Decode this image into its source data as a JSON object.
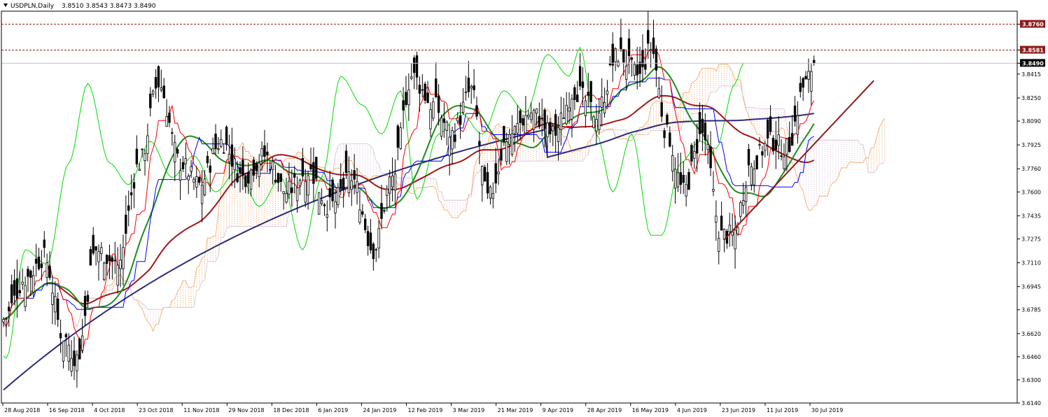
{
  "header": {
    "symbol_label": "USDPLN,Daily",
    "ohlc_label": "3.8510 3.8543 3.8473 3.8490"
  },
  "colors": {
    "candle": "#000000",
    "ma_fast": "#1e8c1e",
    "ma_mid": "#a01818",
    "ma_slow": "#2b2b7a",
    "kijun": "#0000ff",
    "tenkan": "#ff0000",
    "chikou": "#00dd00",
    "cloud_a": "#f4a460",
    "cloud_b": "#d8bfd8",
    "trendline": "#8b1a1a",
    "level": "#8b1a1a",
    "tag_bg": "#8b1a1a",
    "current_tag_bg": "#000000"
  },
  "chart_data": {
    "type": "candlestick",
    "symbol": "USDPLN",
    "timeframe": "Daily",
    "ylim": [
      3.614,
      3.885
    ],
    "y_ticks": [
      "3.8760",
      "3.8581",
      "3.8490",
      "3.8415",
      "3.8250",
      "3.8090",
      "3.7925",
      "3.7760",
      "3.7600",
      "3.7435",
      "3.7275",
      "3.7110",
      "3.6945",
      "3.6785",
      "3.6620",
      "3.6460",
      "3.6300",
      "3.6140"
    ],
    "x_ticks": [
      "28 Aug 2018",
      "16 Sep 2018",
      "4 Oct 2018",
      "23 Oct 2018",
      "11 Nov 2018",
      "29 Nov 2018",
      "18 Dec 2018",
      "6 Jan 2019",
      "24 Jan 2019",
      "12 Feb 2019",
      "3 Mar 2019",
      "21 Mar 2019",
      "9 Apr 2019",
      "28 Apr 2019",
      "16 May 2019",
      "4 Jun 2019",
      "23 Jun 2019",
      "11 Jul 2019",
      "30 Jul 2019"
    ],
    "levels": [
      {
        "label": "3.8760",
        "value": 3.876
      },
      {
        "label": "3.8581",
        "value": 3.8581
      }
    ],
    "current_price": {
      "label": "3.8490",
      "value": 3.849
    },
    "anchors": [
      {
        "x": 0,
        "close": 3.672
      },
      {
        "x": 8,
        "close": 3.7
      },
      {
        "x": 15,
        "close": 3.715
      },
      {
        "x": 22,
        "close": 3.66
      },
      {
        "x": 27,
        "close": 3.645
      },
      {
        "x": 34,
        "close": 3.72
      },
      {
        "x": 42,
        "close": 3.71
      },
      {
        "x": 50,
        "close": 3.78
      },
      {
        "x": 57,
        "close": 3.835
      },
      {
        "x": 65,
        "close": 3.78
      },
      {
        "x": 72,
        "close": 3.765
      },
      {
        "x": 80,
        "close": 3.795
      },
      {
        "x": 88,
        "close": 3.77
      },
      {
        "x": 96,
        "close": 3.785
      },
      {
        "x": 104,
        "close": 3.76
      },
      {
        "x": 112,
        "close": 3.775
      },
      {
        "x": 120,
        "close": 3.75
      },
      {
        "x": 128,
        "close": 3.77
      },
      {
        "x": 136,
        "close": 3.72
      },
      {
        "x": 143,
        "close": 3.77
      },
      {
        "x": 150,
        "close": 3.84
      },
      {
        "x": 158,
        "close": 3.82
      },
      {
        "x": 165,
        "close": 3.8
      },
      {
        "x": 172,
        "close": 3.83
      },
      {
        "x": 178,
        "close": 3.755
      },
      {
        "x": 186,
        "close": 3.8
      },
      {
        "x": 194,
        "close": 3.815
      },
      {
        "x": 202,
        "close": 3.8
      },
      {
        "x": 210,
        "close": 3.83
      },
      {
        "x": 218,
        "close": 3.815
      },
      {
        "x": 226,
        "close": 3.855
      },
      {
        "x": 234,
        "close": 3.84
      },
      {
        "x": 238,
        "close": 3.86
      },
      {
        "x": 244,
        "close": 3.8
      },
      {
        "x": 250,
        "close": 3.76
      },
      {
        "x": 257,
        "close": 3.8
      },
      {
        "x": 264,
        "close": 3.73
      },
      {
        "x": 268,
        "close": 3.73
      },
      {
        "x": 275,
        "close": 3.78
      },
      {
        "x": 282,
        "close": 3.795
      },
      {
        "x": 288,
        "close": 3.79
      },
      {
        "x": 295,
        "close": 3.835
      },
      {
        "x": 298,
        "close": 3.849
      }
    ],
    "bars_total": 298,
    "trendline": {
      "from": {
        "x": 265,
        "value": 3.727
      },
      "to": {
        "x": 320,
        "value": 3.837
      }
    },
    "lines": [
      "ma_fast",
      "ma_mid",
      "ma_slow",
      "kijun",
      "tenkan",
      "chikou"
    ],
    "grid": false
  }
}
